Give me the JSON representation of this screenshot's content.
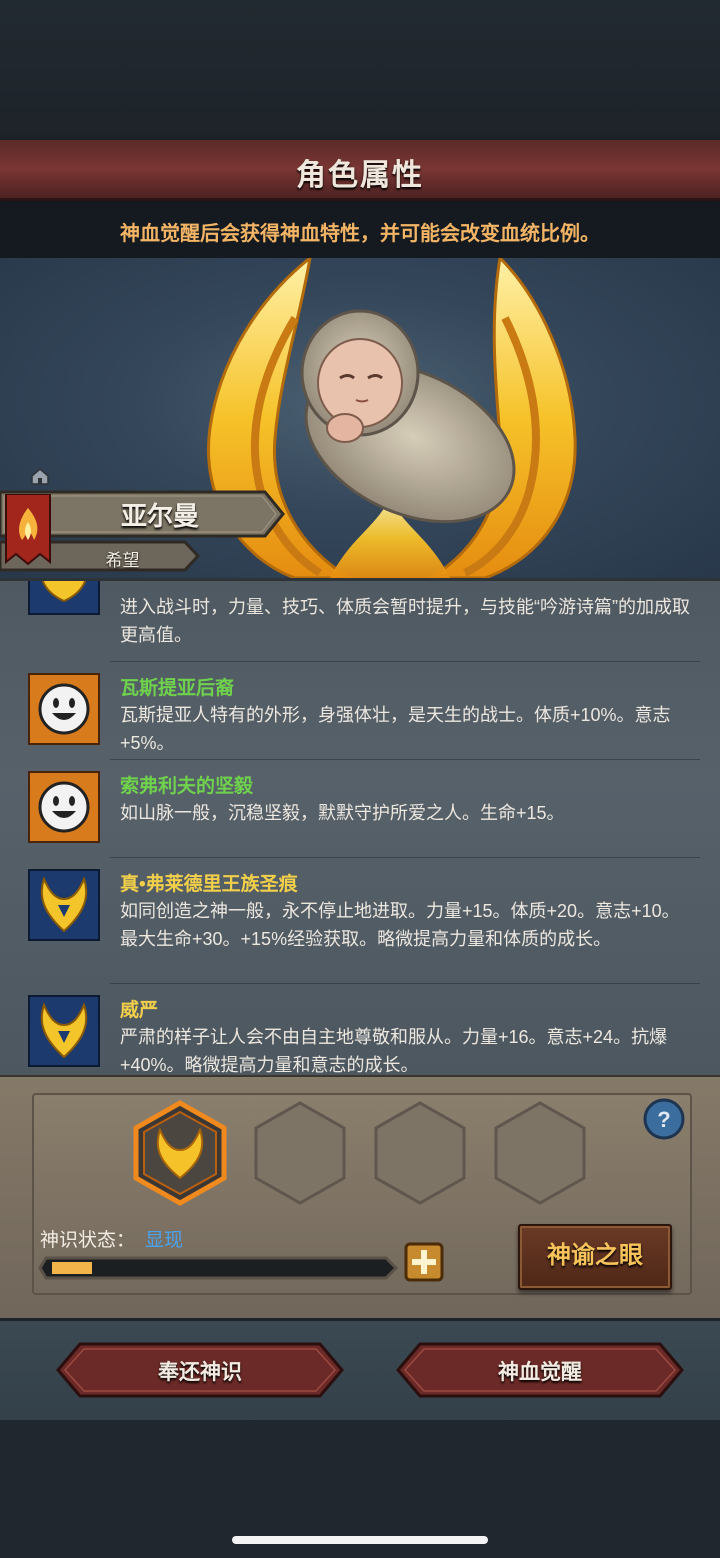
{
  "header": {
    "title": "角色属性",
    "hint": "神血觉醒后会获得神血特性，并可能会改变血统比例。"
  },
  "character": {
    "name": "亚尔曼",
    "title": "希望"
  },
  "traits": [
    {
      "name": "",
      "icon": "golden-crown-icon",
      "desc": "进入战斗时，力量、技巧、体质会暂时提升，与技能“吟游诗篇”的加成取更高值。"
    },
    {
      "name": "瓦斯提亚后裔",
      "icon": "smiley-face-icon",
      "name_color": "#6fd24c",
      "desc": "瓦斯提亚人特有的外形，身强体壮，是天生的战士。体质+10%。意志+5%。"
    },
    {
      "name": "索弗利夫的坚毅",
      "icon": "smiley-face-icon",
      "name_color": "#6fd24c",
      "desc": "如山脉一般，沉稳坚毅，默默守护所爱之人。生命+15。"
    },
    {
      "name": "真•弗莱德里王族圣痕",
      "icon": "golden-crown-icon",
      "name_color": "#f1cf4a",
      "desc": "如同创造之神一般，永不停止地进取。力量+15。体质+20。意志+10。最大生命+30。+15%经验获取。略微提高力量和体质的成长。"
    },
    {
      "name": "威严",
      "icon": "golden-crown-icon",
      "name_color": "#f1cf4a",
      "desc": "严肃的样子让人会不由自主地尊敬和服从。力量+16。意志+24。抗爆+40%。略微提高力量和意志的成长。"
    }
  ],
  "divine": {
    "status_label": "神识状态：",
    "status_value": "显现",
    "progress": 0.12,
    "oracle_button": "神谕之眼"
  },
  "actions": {
    "return_label": "奉还神识",
    "awaken_label": "神血觉醒"
  },
  "colors": {
    "accent_orange": "#f3b565",
    "status_blue": "#4aa3f0",
    "trait_green": "#6fd24c",
    "trait_gold": "#f1cf4a"
  }
}
